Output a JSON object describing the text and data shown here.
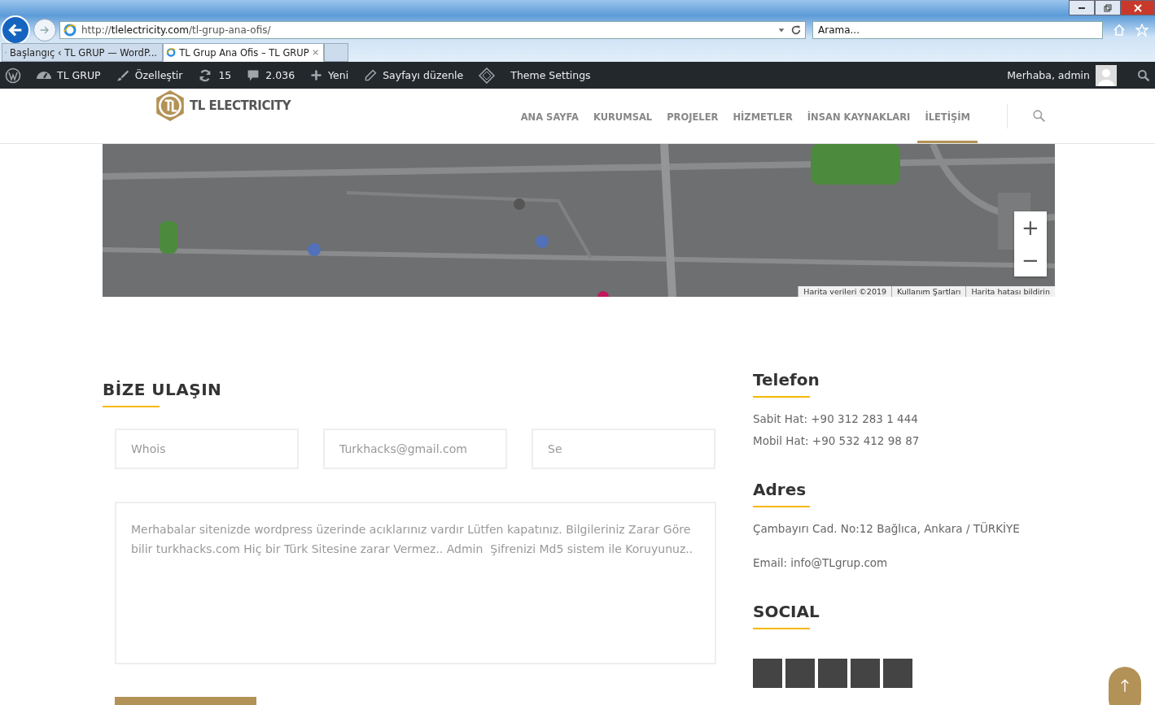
{
  "browser": {
    "url_prefix": "http://",
    "url_domain": "tlelectricity.com",
    "url_path": "/tl-grup-ana-ofis/",
    "search_placeholder": "Arama...",
    "tabs": [
      {
        "label": "Başlangıç ‹ TL GRUP — WordP...",
        "selected": false
      },
      {
        "label": "TL Grup Ana Ofis – TL GRUP",
        "selected": true
      }
    ]
  },
  "admin_bar": {
    "items": [
      {
        "kind": "wp"
      },
      {
        "kind": "site",
        "label": "TL GRUP"
      },
      {
        "kind": "brush",
        "label": "Özelleştir"
      },
      {
        "kind": "updates",
        "label": "15"
      },
      {
        "kind": "comments",
        "label": "2.036"
      },
      {
        "kind": "plus",
        "label": "Yeni"
      },
      {
        "kind": "pencil",
        "label": "Sayfayı düzenle"
      },
      {
        "kind": "diamond"
      },
      {
        "kind": "text",
        "label": "Theme Settings"
      }
    ],
    "greeting": "Merhaba, admin"
  },
  "site": {
    "logo_text": "TL ELECTRICITY",
    "nav": [
      {
        "label": "ANA SAYFA",
        "selected": false
      },
      {
        "label": "KURUMSAL",
        "selected": false
      },
      {
        "label": "PROJELER",
        "selected": false
      },
      {
        "label": "HİZMETLER",
        "selected": false
      },
      {
        "label": "İNSAN KAYNAKLARI",
        "selected": false
      },
      {
        "label": "İLETİŞİM",
        "selected": true
      }
    ]
  },
  "map": {
    "kind": "picture",
    "attribution": [
      "Harita verileri ©2019",
      "Kullanım Şartları",
      "Harita hatası bildirin"
    ],
    "zoom_in": "+",
    "zoom_out": "−"
  },
  "contact_form": {
    "title": "BİZE ULAŞIN",
    "fields": [
      {
        "value": "Whois"
      },
      {
        "value": "Turkhacks@gmail.com"
      },
      {
        "value": "Se"
      }
    ],
    "message": "Merhabalar sitenizde wordpress üzerinde acıklarınız vardır Lütfen kapatınız. Bilgileriniz Zarar Göre bilir turkhacks.com Hiç bir Türk Sitesine zarar Vermez.. Admin  Şifrenizi Md5 sistem ile Koruyunuz.."
  },
  "sidebar": {
    "sections": [
      {
        "title": "Telefon",
        "paragraphs": [
          [
            "Sabit Hat: +90 312 283 1 444",
            "Mobil Hat: +90 532 412 98 87"
          ]
        ]
      },
      {
        "title": "Adres",
        "paragraphs": [
          [
            "Çambayırı Cad. No:12 Bağlıca, Ankara / TÜRKİYE"
          ],
          [
            "Email: info@TLgrup.com"
          ]
        ]
      },
      {
        "title": "SOCIAL"
      }
    ],
    "social_links": [
      {
        "kind": "button"
      },
      {
        "kind": "button"
      },
      {
        "kind": "button"
      },
      {
        "kind": "button"
      },
      {
        "kind": "button"
      }
    ]
  }
}
